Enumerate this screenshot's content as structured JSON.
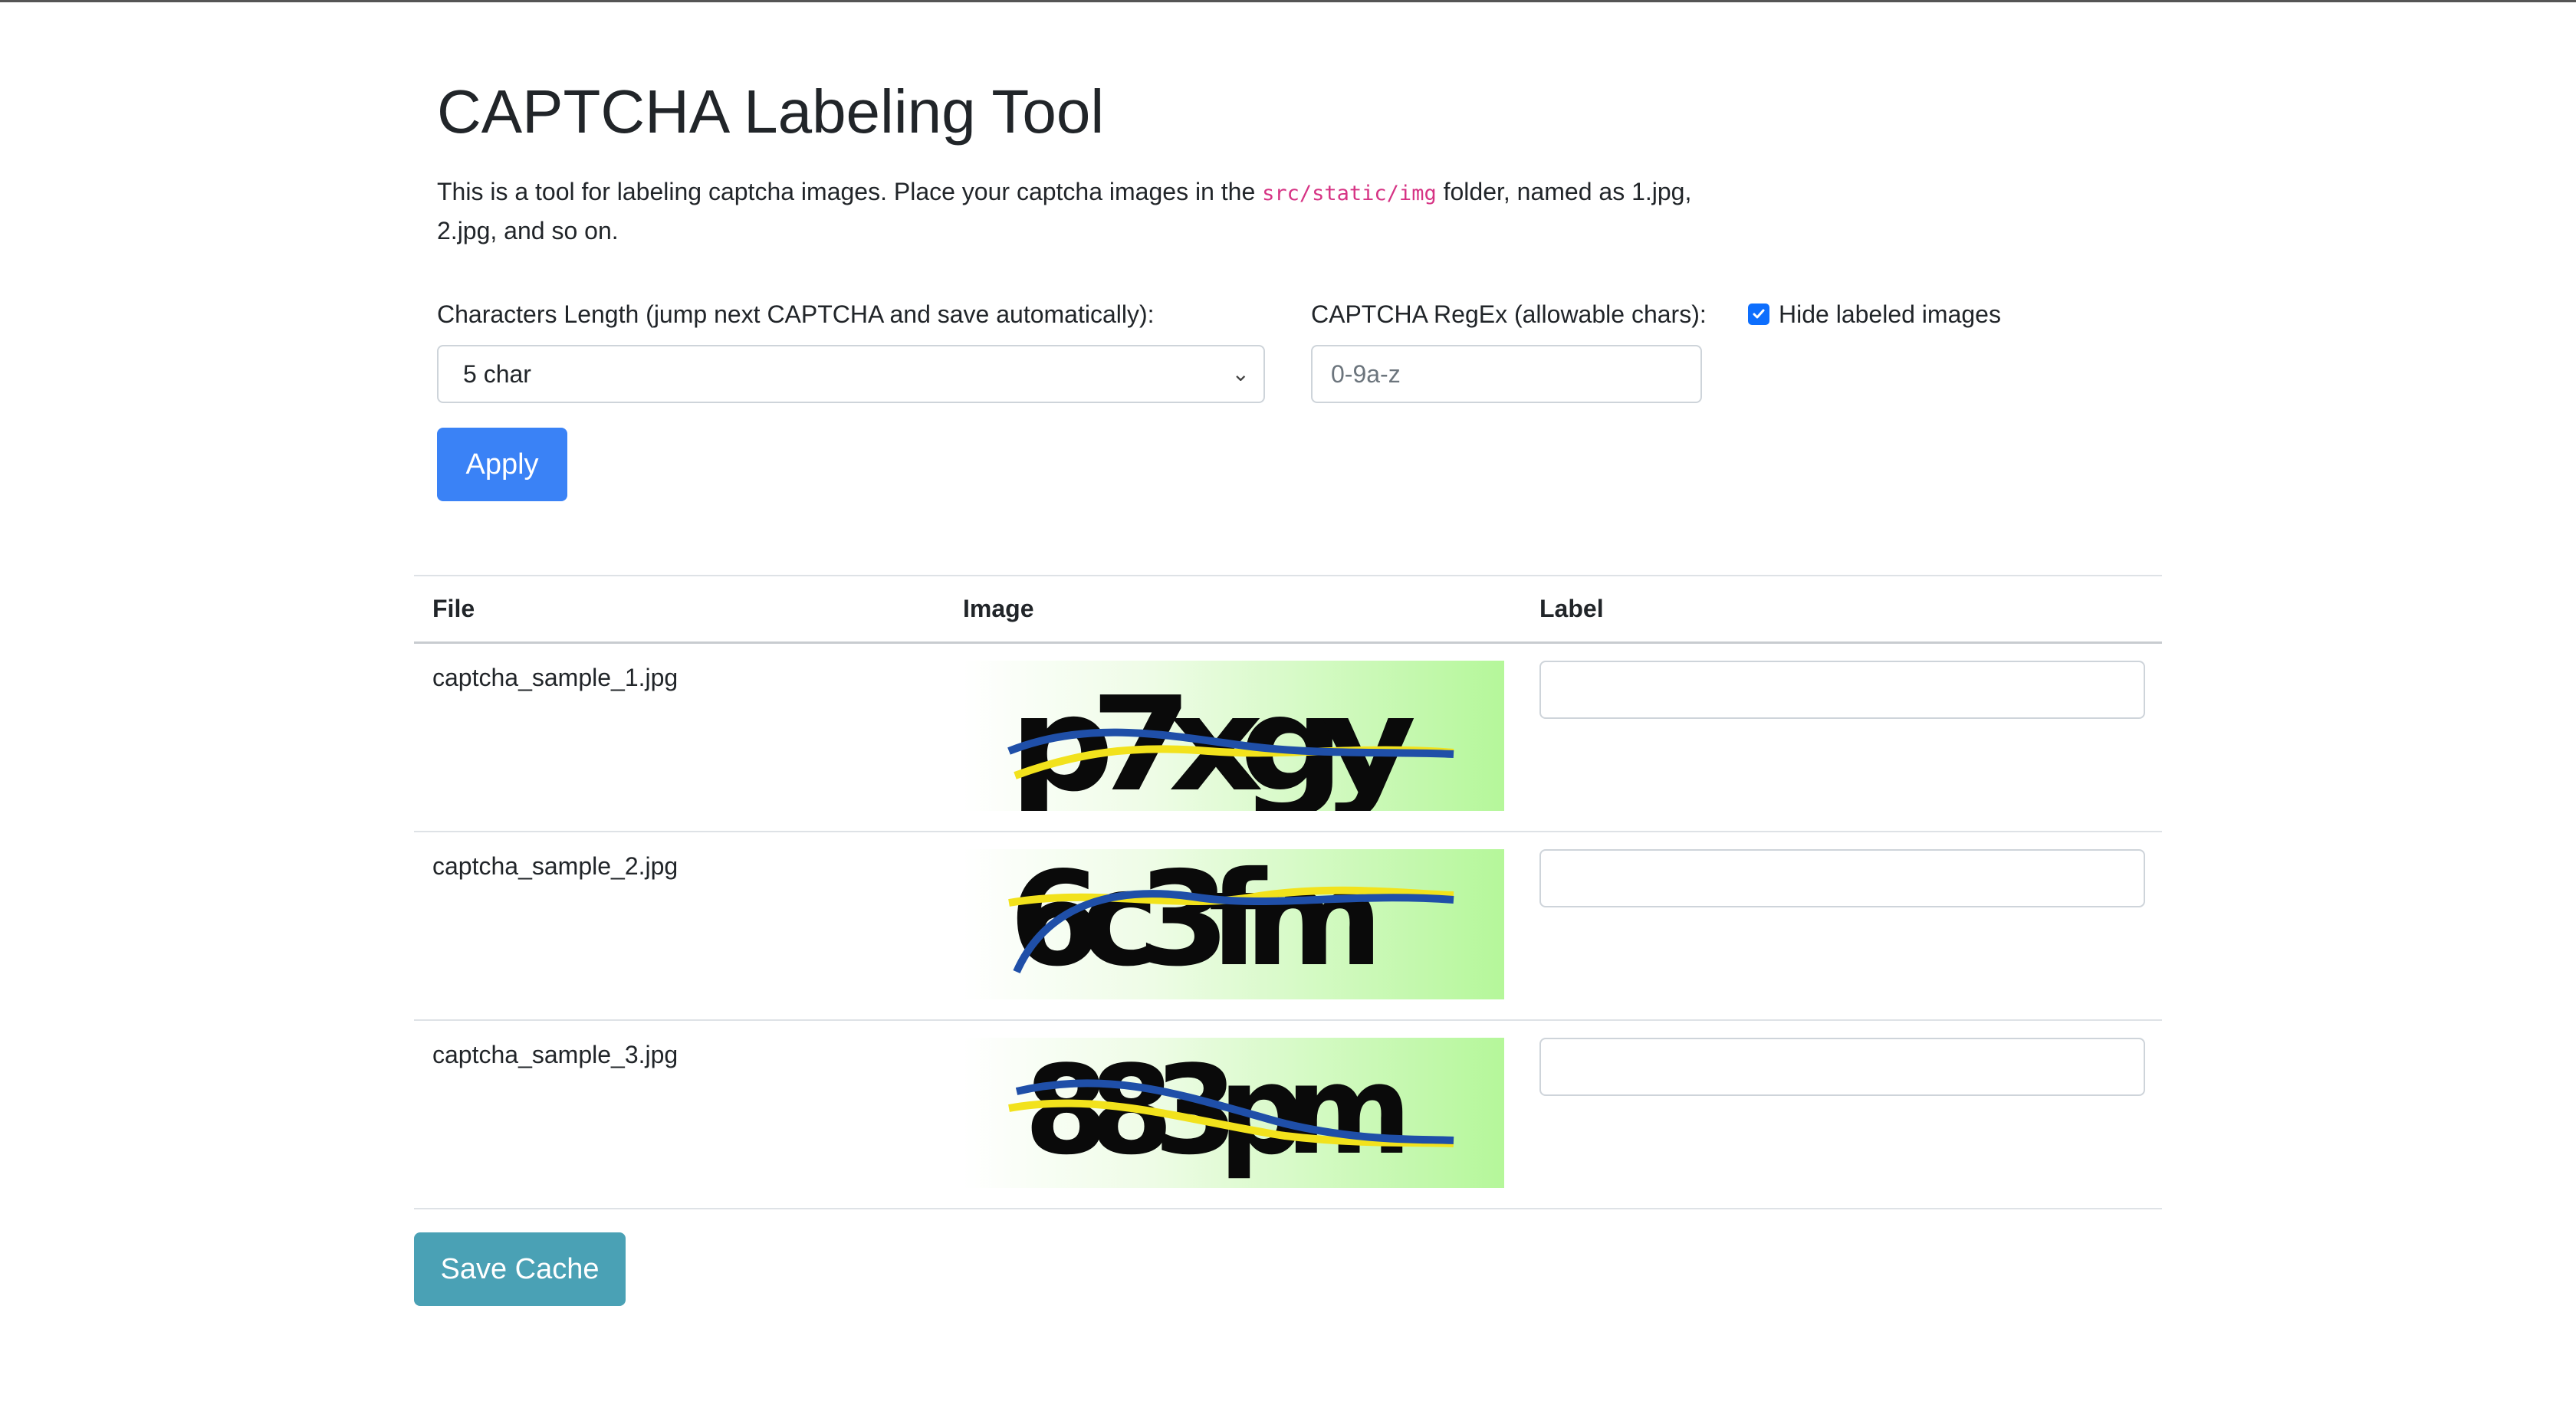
{
  "header": {
    "title": "CAPTCHA Labeling Tool",
    "desc_part1": "This is a tool for labeling captcha images. Place your captcha images in the ",
    "desc_code": "src/static/img",
    "desc_part2": " folder, named as 1.jpg, 2.jpg, and so on."
  },
  "form": {
    "length_label": "Characters Length (jump next CAPTCHA and save automatically):",
    "length_selected": "5 char",
    "regex_label": "CAPTCHA RegEx (allowable chars):",
    "regex_placeholder": "0-9a-z",
    "hide_label": "Hide labeled images",
    "hide_checked": true,
    "apply_label": "Apply"
  },
  "table": {
    "headers": [
      "File",
      "Image",
      "Label"
    ],
    "rows": [
      {
        "file": "captcha_sample_1.jpg",
        "captcha_text": "p7xgy",
        "label": ""
      },
      {
        "file": "captcha_sample_2.jpg",
        "captcha_text": "6c3fm",
        "label": ""
      },
      {
        "file": "captcha_sample_3.jpg",
        "captcha_text": "883pm",
        "label": ""
      }
    ]
  },
  "footer": {
    "save_label": "Save Cache"
  },
  "colors": {
    "primary": "#3a82f6",
    "info": "#4aa1b5",
    "code": "#d63384",
    "captcha_green": "#b5f79a",
    "captcha_line_blue": "#1f4fa8",
    "captcha_line_yellow": "#f2e21c"
  }
}
